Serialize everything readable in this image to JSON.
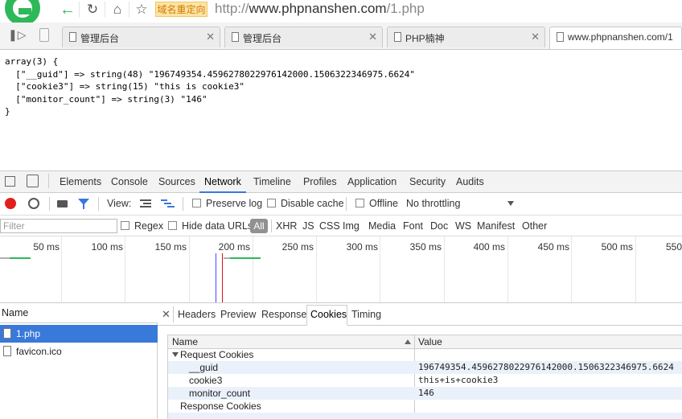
{
  "browser": {
    "redirect_badge": "域名重定向",
    "url_host": "www.phpnanshen.com",
    "url_prefix": "http://",
    "url_path": "/1.php"
  },
  "tabs": [
    {
      "label": "管理后台"
    },
    {
      "label": "管理后台"
    },
    {
      "label": "PHP楠神"
    },
    {
      "label": "www.phpnanshen.com/1"
    }
  ],
  "page": {
    "output": "array(3) {\n  [\"__guid\"] => string(48) \"196749354.4596278022976142000.1506322346975.6624\"\n  [\"cookie3\"] => string(15) \"this is cookie3\"\n  [\"monitor_count\"] => string(3) \"146\"\n}"
  },
  "devtools": {
    "tabs": [
      "Elements",
      "Console",
      "Sources",
      "Network",
      "Timeline",
      "Profiles",
      "Application",
      "Security",
      "Audits"
    ],
    "selected_tab": "Network",
    "toolbar": {
      "view_label": "View:",
      "preserve_log": "Preserve log",
      "disable_cache": "Disable cache",
      "offline": "Offline",
      "throttling": "No throttling"
    },
    "filter": {
      "placeholder": "Filter",
      "regex": "Regex",
      "hide_data_urls": "Hide data URLs",
      "all": "All",
      "types": [
        "XHR",
        "JS",
        "CSS",
        "Img",
        "Media",
        "Font",
        "Doc",
        "WS",
        "Manifest",
        "Other"
      ]
    },
    "timeline_ticks": [
      "50 ms",
      "100 ms",
      "150 ms",
      "200 ms",
      "250 ms",
      "300 ms",
      "350 ms",
      "400 ms",
      "450 ms",
      "500 ms",
      "550"
    ],
    "requests": {
      "header": "Name",
      "items": [
        {
          "name": "1.php",
          "selected": true
        },
        {
          "name": "favicon.ico",
          "selected": false
        }
      ]
    },
    "detail": {
      "close": "✕",
      "tabs": [
        "Headers",
        "Preview",
        "Response",
        "Cookies",
        "Timing"
      ],
      "selected_tab": "Cookies",
      "cookies": {
        "col_name": "Name",
        "col_value": "Value",
        "request_group": "Request Cookies",
        "rows": [
          {
            "name": "__guid",
            "value": "196749354.4596278022976142000.1506322346975.6624"
          },
          {
            "name": "cookie3",
            "value": "this+is+cookie3"
          },
          {
            "name": "monitor_count",
            "value": "146"
          }
        ],
        "response_group": "Response Cookies"
      }
    },
    "colors": {
      "accent": "#3879d9",
      "record": "#e0201b"
    }
  }
}
